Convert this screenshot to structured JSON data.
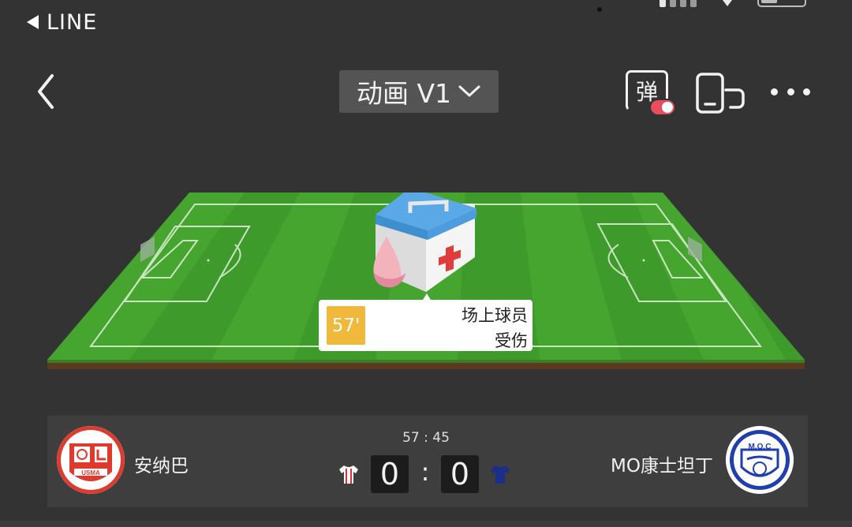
{
  "status_bar": {
    "back_app_label": "LINE"
  },
  "nav": {
    "mode_label": "动画 V1",
    "danmaku_label": "弹",
    "danmaku_enabled": true
  },
  "event": {
    "minute": "57'",
    "title": "场上球员",
    "detail": "受伤",
    "icon": "first-aid-kit-icon"
  },
  "match": {
    "clock": "57 : 45",
    "home": {
      "name": "安纳巴",
      "score": "0",
      "logo_text": "USMA",
      "jersey_color": "#ffffff",
      "jersey_stripe_color": "#d9313a"
    },
    "away": {
      "name": "MO康士坦丁",
      "score": "0",
      "logo_text": "M.O.C",
      "jersey_color": "#1a2f8a"
    }
  },
  "colors": {
    "background": "#333333",
    "pitch_green": "#3e9a2b",
    "event_minute_badge": "#f0b93b",
    "danmaku_toggle": "#e84c5d"
  }
}
